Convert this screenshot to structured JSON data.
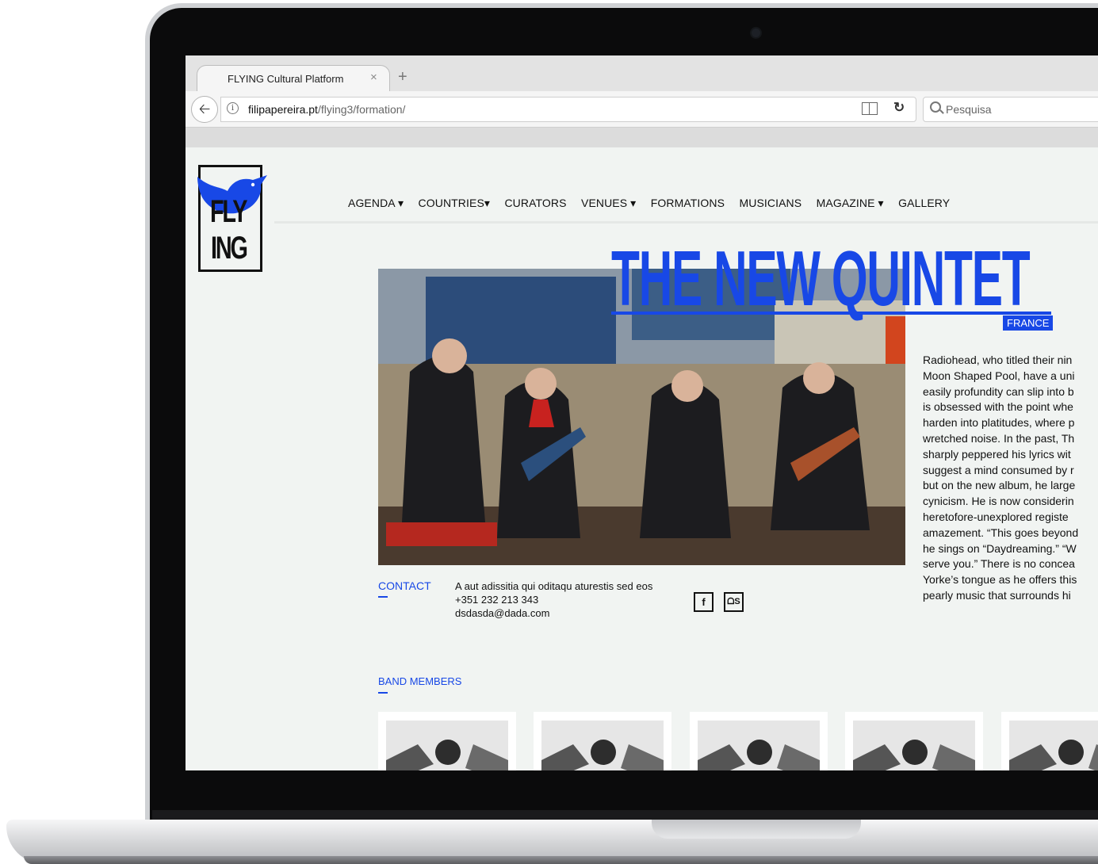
{
  "browser": {
    "tab_title": "FLYING Cultural Platform",
    "tab_close": "×",
    "new_tab": "+",
    "url_domain": "filipapereira.pt",
    "url_path": "/flying3/formation/",
    "search_placeholder": "Pesquisa"
  },
  "logo": {
    "line1": "FLY",
    "line2": "ING"
  },
  "nav": {
    "items": [
      "AGENDA ▾",
      "COUNTRIES▾",
      "CURATORS",
      "VENUES ▾",
      "FORMATIONS",
      "MUSICIANS",
      "MAGAZINE ▾",
      "GALLERY"
    ]
  },
  "formation": {
    "title": "THE NEW QUINTET",
    "country": "FRANCE",
    "description_lines": [
      "Radiohead, who titled their nin",
      "Moon Shaped Pool, have a uni",
      "easily profundity can slip into b",
      "is obsessed with the point whe",
      "harden into platitudes, where p",
      "wretched noise. In the past, Th",
      "sharply peppered his lyrics wit",
      "suggest a mind consumed by r",
      "but on the new album, he large",
      "cynicism. He is now considerin",
      "heretofore-unexplored registe",
      "amazement. “This goes beyond",
      "he sings on “Daydreaming.” “W",
      "serve you.” There is no concea",
      "Yorke’s tongue as he offers this",
      "pearly music that surrounds hi"
    ]
  },
  "contact": {
    "label": "CONTACT",
    "address": "A aut adissitia qui oditaqu aturestis sed eos",
    "phone": "+351 232 213 343",
    "email": "dsdasda@dada.com",
    "facebook": "f",
    "lastfm": "ᗝS"
  },
  "band": {
    "label": "BAND MEMBERS",
    "members_visible": 5
  },
  "colors": {
    "accent": "#1848e6",
    "page_bg": "#f1f4f2"
  }
}
